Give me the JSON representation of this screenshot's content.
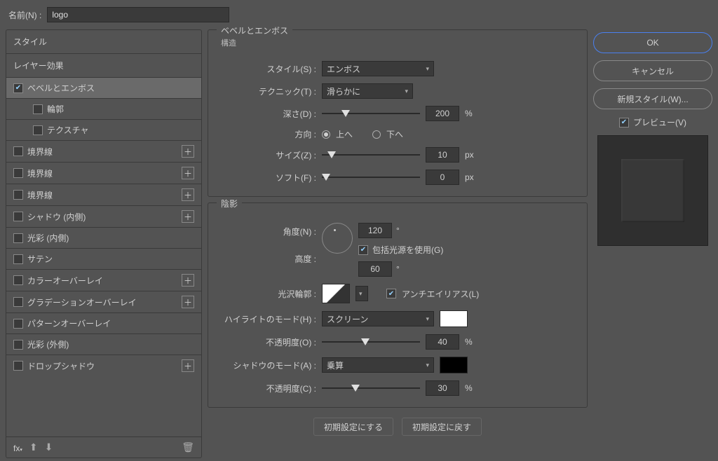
{
  "header": {
    "name_label": "名前(N) :",
    "name_value": "logo"
  },
  "sidebar": {
    "styles_label": "スタイル",
    "layer_effects_label": "レイヤー効果",
    "items": [
      {
        "label": "ベベルとエンボス",
        "checked": true,
        "selected": true,
        "plus": false
      },
      {
        "label": "輪郭",
        "checked": false,
        "plus": false,
        "indent": true
      },
      {
        "label": "テクスチャ",
        "checked": false,
        "plus": false,
        "indent": true
      },
      {
        "label": "境界線",
        "checked": false,
        "plus": true
      },
      {
        "label": "境界線",
        "checked": false,
        "plus": true
      },
      {
        "label": "境界線",
        "checked": false,
        "plus": true
      },
      {
        "label": "シャドウ (内側)",
        "checked": false,
        "plus": true
      },
      {
        "label": "光彩 (内側)",
        "checked": false,
        "plus": false
      },
      {
        "label": "サテン",
        "checked": false,
        "plus": false
      },
      {
        "label": "カラーオーバーレイ",
        "checked": false,
        "plus": true
      },
      {
        "label": "グラデーションオーバーレイ",
        "checked": false,
        "plus": true
      },
      {
        "label": "パターンオーバーレイ",
        "checked": false,
        "plus": false
      },
      {
        "label": "光彩 (外側)",
        "checked": false,
        "plus": false
      },
      {
        "label": "ドロップシャドウ",
        "checked": false,
        "plus": true
      }
    ],
    "footer": {
      "fx": "fx",
      "up": "⬆",
      "down": "⬇",
      "trash": "🗑"
    }
  },
  "structure": {
    "group_title": "ベベルとエンボス",
    "sub_title": "構造",
    "style_label": "スタイル(S) :",
    "style_value": "エンボス",
    "technique_label": "テクニック(T) :",
    "technique_value": "滑らかに",
    "depth_label": "深さ(D) :",
    "depth_value": "200",
    "depth_unit": "%",
    "direction_label": "方向 :",
    "dir_up": "上へ",
    "dir_down": "下へ",
    "size_label": "サイズ(Z) :",
    "size_value": "10",
    "size_unit": "px",
    "soften_label": "ソフト(F) :",
    "soften_value": "0",
    "soften_unit": "px"
  },
  "shading": {
    "group_title": "陰影",
    "angle_label": "角度(N) :",
    "angle_value": "120",
    "angle_unit": "°",
    "global_light_label": "包括光源を使用(G)",
    "altitude_label": "高度 :",
    "altitude_value": "60",
    "altitude_unit": "°",
    "gloss_label": "光沢輪郭 :",
    "antialias_label": "アンチエイリアス(L)",
    "highlight_mode_label": "ハイライトのモード(H) :",
    "highlight_mode_value": "スクリーン",
    "highlight_opacity_label": "不透明度(O) :",
    "highlight_opacity_value": "40",
    "opacity_unit": "%",
    "shadow_mode_label": "シャドウのモード(A) :",
    "shadow_mode_value": "乗算",
    "shadow_opacity_label": "不透明度(C) :",
    "shadow_opacity_value": "30"
  },
  "bottom_buttons": {
    "make_default": "初期設定にする",
    "reset_default": "初期設定に戻す"
  },
  "right": {
    "ok": "OK",
    "cancel": "キャンセル",
    "new_style": "新規スタイル(W)...",
    "preview": "プレビュー(V)"
  }
}
